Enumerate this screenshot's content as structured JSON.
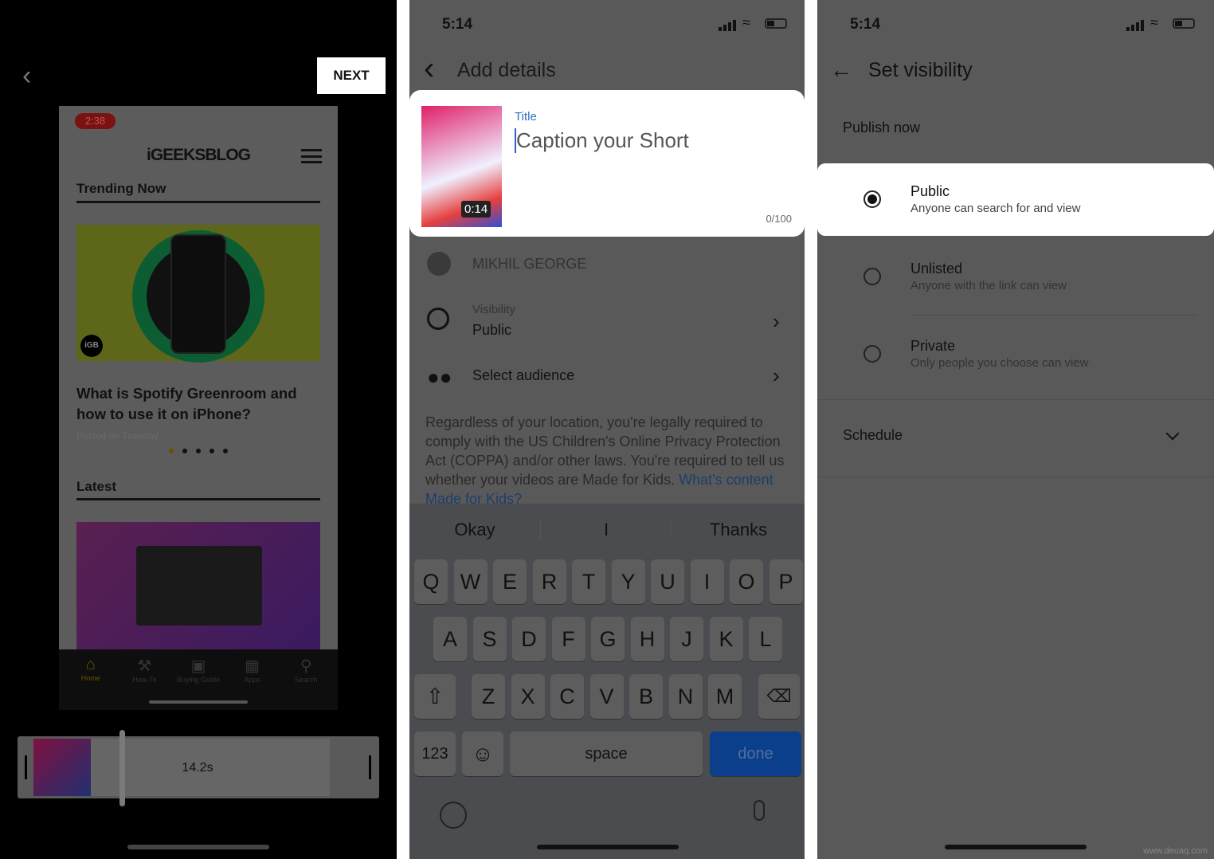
{
  "panel1": {
    "next_label": "NEXT",
    "status_time": "2:38",
    "logo": "iGEEKSBLOG",
    "trending_heading": "Trending Now",
    "article_title": "What is Spotify Greenroom and how to use it on iPhone?",
    "article_meta": "Posted on Tuesday",
    "latest_heading": "Latest",
    "badge": "iGB",
    "nav": [
      {
        "label": "Home",
        "icon": "home-icon"
      },
      {
        "label": "How-To",
        "icon": "wrench-icon"
      },
      {
        "label": "Buying Guide",
        "icon": "bag-icon"
      },
      {
        "label": "Apps",
        "icon": "grid-icon"
      },
      {
        "label": "Search",
        "icon": "search-icon"
      }
    ],
    "timeline_duration": "14.2s",
    "accent": "#e0b000"
  },
  "panel2": {
    "status_time": "5:14",
    "header_title": "Add details",
    "title_label": "Title",
    "title_placeholder": "Caption your Short",
    "char_count": "0/100",
    "thumb_duration": "0:14",
    "channel_name": "MIKHIL GEORGE",
    "visibility_label": "Visibility",
    "visibility_value": "Public",
    "audience_label": "Select audience",
    "notice": "Regardless of your location, you're legally required to comply with the US Children's Online Privacy Protection Act (COPPA) and/or other laws. You're required to tell us whether your videos are Made for Kids. ",
    "notice_link": "What's content Made for Kids?",
    "suggestions": [
      "Okay",
      "I",
      "Thanks"
    ],
    "row1": [
      "Q",
      "W",
      "E",
      "R",
      "T",
      "Y",
      "U",
      "I",
      "O",
      "P"
    ],
    "row2": [
      "A",
      "S",
      "D",
      "F",
      "G",
      "H",
      "J",
      "K",
      "L"
    ],
    "row3": [
      "Z",
      "X",
      "C",
      "V",
      "B",
      "N",
      "M"
    ],
    "key_123": "123",
    "key_space": "space",
    "key_done": "done",
    "accent": "#0b57d0"
  },
  "panel3": {
    "status_time": "5:14",
    "header_title": "Set visibility",
    "publish_now": "Publish now",
    "options": [
      {
        "title": "Public",
        "desc": "Anyone can search for and view",
        "selected": true
      },
      {
        "title": "Unlisted",
        "desc": "Anyone with the link can view",
        "selected": false
      },
      {
        "title": "Private",
        "desc": "Only people you choose can view",
        "selected": false
      }
    ],
    "schedule": "Schedule"
  },
  "watermark": "www.deuaq.com"
}
